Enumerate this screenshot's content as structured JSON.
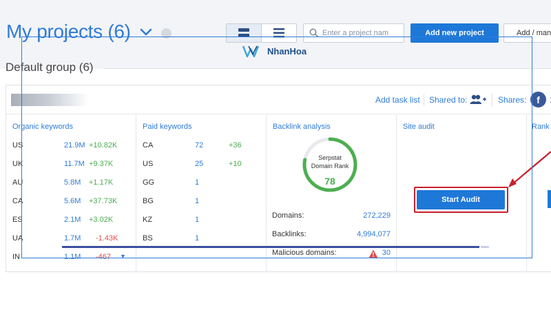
{
  "header": {
    "title": "My projects (6)",
    "search_placeholder": "Enter a project nam",
    "add_project_label": "Add new project",
    "add_manage_label": "Add / man"
  },
  "watermark": {
    "brand": "NhanHoa"
  },
  "group": {
    "title": "Default group (6)"
  },
  "card_header": {
    "add_task_label": "Add task list",
    "shared_to_label": "Shared to:",
    "shares_label": "Shares:",
    "shares_count": "1"
  },
  "organic": {
    "title": "Organic keywords",
    "rows": [
      {
        "country": "US",
        "value": "21.9M",
        "change": "+10.82K",
        "trend": "up"
      },
      {
        "country": "UK",
        "value": "11.7M",
        "change": "+9.37K",
        "trend": "up"
      },
      {
        "country": "AU",
        "value": "5.8M",
        "change": "+1.17K",
        "trend": "up"
      },
      {
        "country": "CA",
        "value": "5.6M",
        "change": "+37.73K",
        "trend": "up"
      },
      {
        "country": "ES",
        "value": "2.1M",
        "change": "+3.02K",
        "trend": "up"
      },
      {
        "country": "UA",
        "value": "1.7M",
        "change": "-1.43K",
        "trend": "down"
      },
      {
        "country": "IN",
        "value": "1.1M",
        "change": "-467",
        "trend": "down"
      }
    ]
  },
  "paid": {
    "title": "Paid keywords",
    "rows": [
      {
        "country": "CA",
        "value": "72",
        "change": "+36"
      },
      {
        "country": "US",
        "value": "25",
        "change": "+10"
      },
      {
        "country": "GG",
        "value": "1",
        "change": ""
      },
      {
        "country": "BG",
        "value": "1",
        "change": ""
      },
      {
        "country": "KZ",
        "value": "1",
        "change": ""
      },
      {
        "country": "BS",
        "value": "1",
        "change": ""
      }
    ]
  },
  "backlink": {
    "title": "Backlink analysis",
    "gauge_label_1": "Serpstat",
    "gauge_label_2": "Domain Rank",
    "domain_rank": "78",
    "domain_rank_fraction": 0.78,
    "domains_label": "Domains:",
    "domains_value": "272,229",
    "backlinks_label": "Backlinks:",
    "backlinks_value": "4,994,077",
    "malicious_label": "Malicious domains:",
    "malicious_value": "30"
  },
  "site_audit": {
    "title": "Site audit",
    "start_label": "Start Audit"
  },
  "rank": {
    "title": "Rank"
  },
  "colors": {
    "accent": "#1e78d8",
    "positive": "#4caf50",
    "negative": "#e04b4b",
    "highlight": "#c8202a"
  }
}
